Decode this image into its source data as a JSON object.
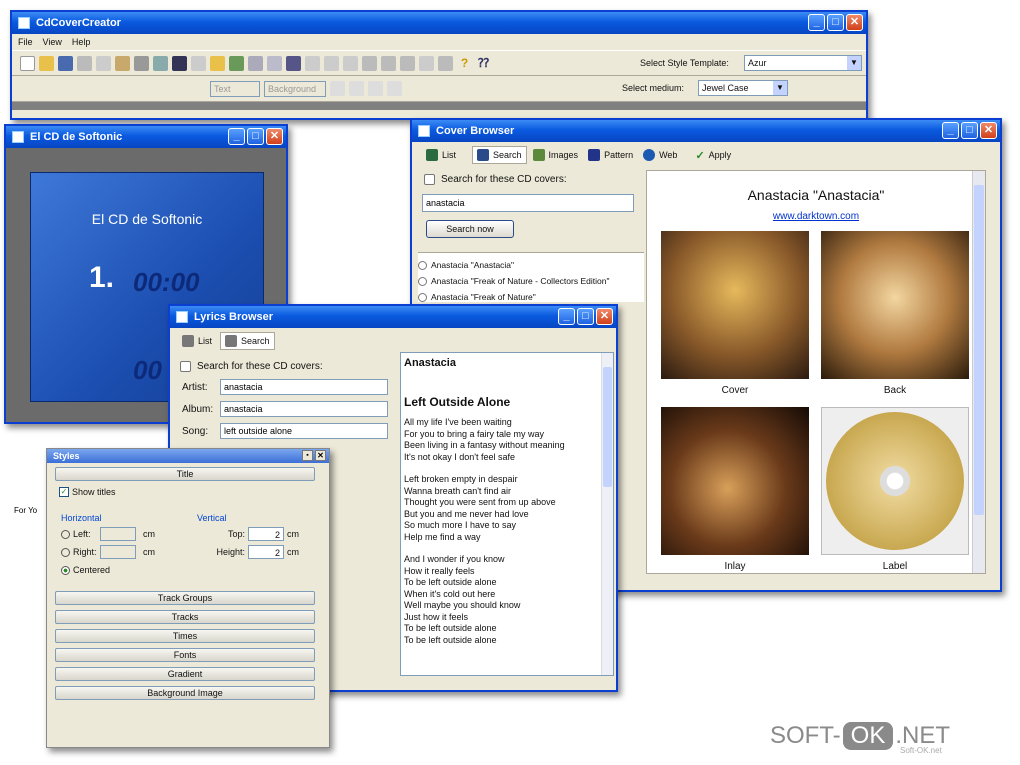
{
  "main_window": {
    "title": "CdCoverCreator",
    "menu": [
      "File",
      "View",
      "Help"
    ],
    "style_template_label": "Select Style Template:",
    "style_template_value": "Azur",
    "medium_label": "Select medium:",
    "medium_value": "Jewel Case",
    "font_value": "Text",
    "font_style_value": "Background"
  },
  "cd_window": {
    "title": "El CD de Softonic",
    "cover_title": "El CD de Softonic",
    "track_number": "1.",
    "track_time": "00:00",
    "second_time": "00",
    "status": "For Yo"
  },
  "cover_browser": {
    "title": "Cover Browser",
    "tabs": [
      "List",
      "Search",
      "Images",
      "Pattern",
      "Web",
      "Apply"
    ],
    "search_label": "Search for these CD covers:",
    "search_value": "anastacia",
    "search_button": "Search now",
    "results": [
      "Anastacia \"Anastacia\"",
      "Anastacia \"Freak of Nature - Collectors Edition\"",
      "Anastacia \"Freak of Nature\""
    ],
    "album_title": "Anastacia \"Anastacia\"",
    "album_link": "www.darktown.com",
    "images": [
      "Cover",
      "Back",
      "Inlay",
      "Label"
    ]
  },
  "lyrics_browser": {
    "title": "Lyrics Browser",
    "tabs": [
      "List",
      "Search"
    ],
    "search_label": "Search for these CD covers:",
    "artist_label": "Artist:",
    "artist_value": "anastacia",
    "album_label": "Album:",
    "album_value": "anastacia",
    "song_label": "Song:",
    "song_value": "left outside alone",
    "artist_heading": "Anastacia",
    "song_heading": "Left Outside Alone",
    "lyrics": [
      "All my life I've been waiting",
      "For you to bring a fairy tale my way",
      "Been living in a fantasy without meaning",
      "It's not okay I don't feel safe",
      "",
      "Left broken empty in despair",
      "Wanna breath can't find air",
      "Thought you were sent from up above",
      "But you and me never had love",
      "So much more I have to say",
      "Help me find a way",
      "",
      "And I wonder if you know",
      "How it really feels",
      "To be left outside alone",
      "When it's cold out here",
      "Well maybe you should know",
      "Just how it feels",
      "To be left outside alone",
      "To be left outside alone"
    ]
  },
  "styles": {
    "title": "Styles",
    "title_section": "Title",
    "show_titles": "Show titles",
    "horizontal": "Horizontal",
    "vertical": "Vertical",
    "left": "Left:",
    "right": "Right:",
    "centered": "Centered",
    "cm": "cm",
    "top": "Top:",
    "top_value": "2",
    "height": "Height:",
    "height_value": "2",
    "sections": [
      "Track Groups",
      "Tracks",
      "Times",
      "Fonts",
      "Gradient",
      "Background Image"
    ]
  },
  "watermark": {
    "soft": "SOFT-",
    "ok": "OK",
    "net": ".NET",
    "sub": "Soft-OK.net"
  }
}
